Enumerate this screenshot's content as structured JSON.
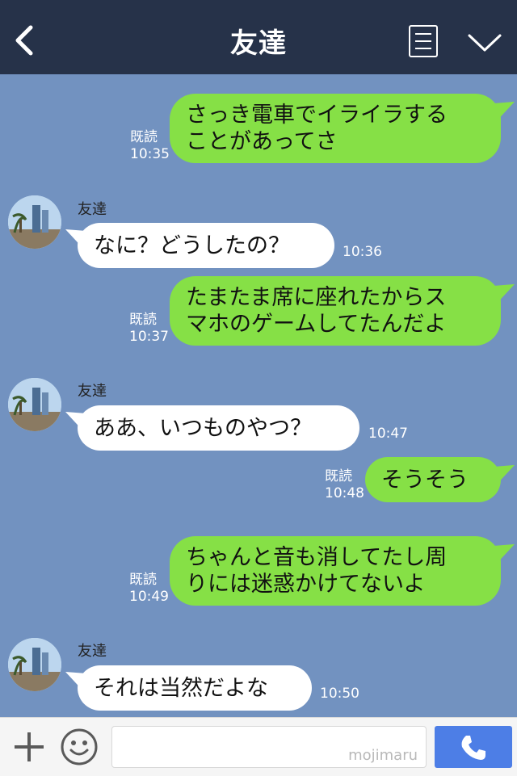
{
  "header": {
    "title": "友達"
  },
  "messages": [
    {
      "dir": "out",
      "read": "既読",
      "time": "10:35",
      "text": "さっき電車でイライラする\nことがあってさ"
    },
    {
      "dir": "in",
      "sender": "友達",
      "time": "10:36",
      "text": "なに？どうしたの？"
    },
    {
      "dir": "out",
      "read": "既読",
      "time": "10:37",
      "text": "たまたま席に座れたからス\nマホのゲームしてたんだよ"
    },
    {
      "dir": "in",
      "sender": "友達",
      "time": "10:47",
      "text": "ああ、いつものやつ？"
    },
    {
      "dir": "out",
      "read": "既読",
      "time": "10:48",
      "text": "そうそう"
    },
    {
      "dir": "out",
      "read": "既読",
      "time": "10:49",
      "text": "ちゃんと音も消してたし周\nりには迷惑かけてないよ"
    },
    {
      "dir": "in",
      "sender": "友達",
      "time": "10:50",
      "text": "それは当然だよな"
    }
  ],
  "input_bar": {
    "watermark": "mojimaru"
  },
  "icons": {
    "back": "chevron-left-icon",
    "menu": "menu-list-icon",
    "collapse": "chevron-down-icon",
    "plus": "plus-icon",
    "emoji": "smiley-icon",
    "call": "phone-icon"
  },
  "colors": {
    "header_bg": "#263249",
    "chat_bg": "#7292c0",
    "outgoing_bubble": "#86e046",
    "incoming_bubble": "#ffffff",
    "call_button": "#4d7ee6"
  }
}
